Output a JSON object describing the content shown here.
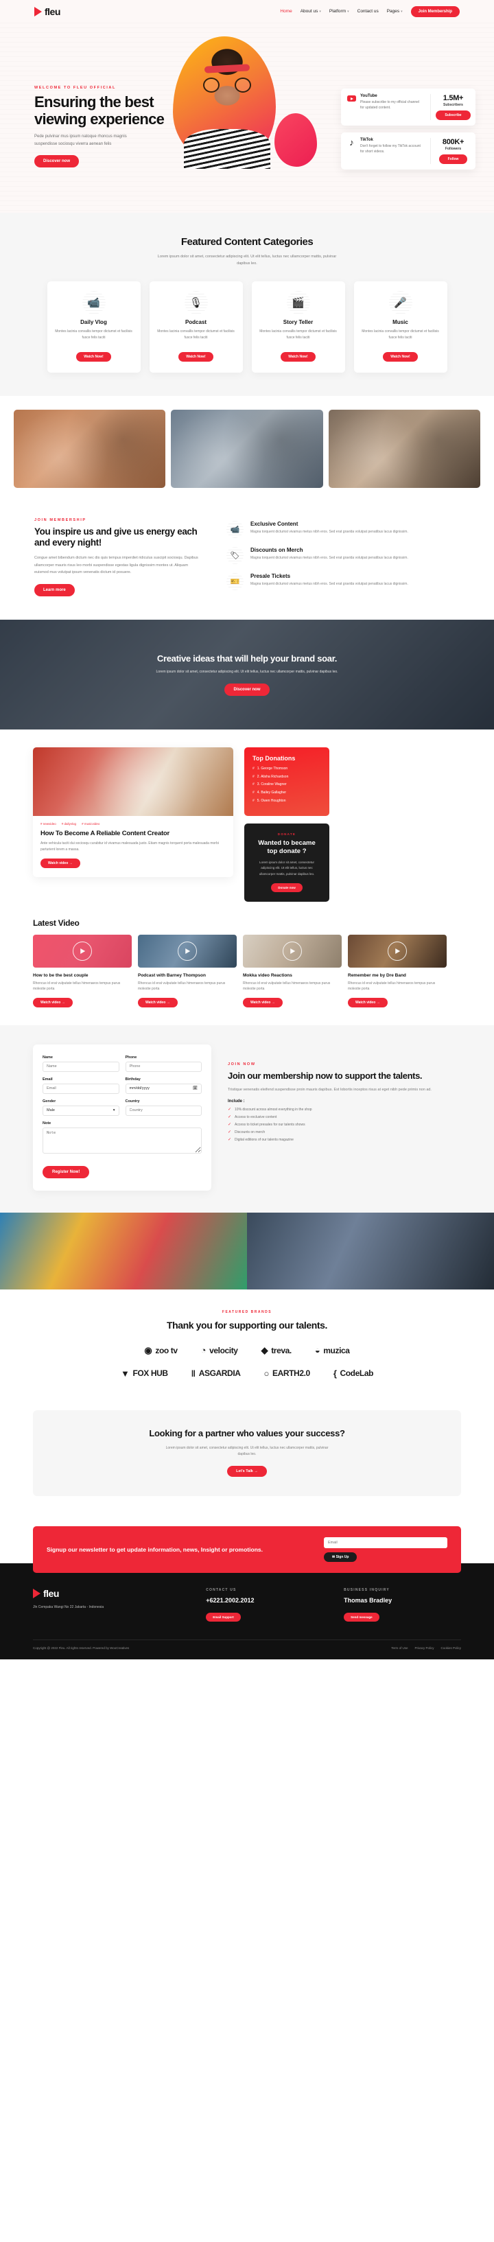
{
  "brand": {
    "name": "fleu",
    "logo_icon": "play-triangle-icon"
  },
  "nav": {
    "items": [
      {
        "label": "Home",
        "active": true,
        "dropdown": false
      },
      {
        "label": "About us",
        "active": false,
        "dropdown": true
      },
      {
        "label": "Platform",
        "active": false,
        "dropdown": true
      },
      {
        "label": "Contact us",
        "active": false,
        "dropdown": false
      },
      {
        "label": "Pages",
        "active": false,
        "dropdown": true
      }
    ],
    "cta_label": "Join Membership"
  },
  "hero": {
    "eyebrow": "WELCOME TO FLEU OFFICIAL",
    "title": "Ensuring the best viewing experience",
    "desc": "Pede pulvinar mus ipsum natoque rhoncus magnis suspendisse sociosqu viverra aenean felis",
    "cta_label": "Discover now",
    "social_cards": [
      {
        "name": "YouTube",
        "icon": "youtube-icon",
        "desc": "Please subscribe to my official channel for updated content.",
        "count": "1.5M+",
        "count_label": "Subscribers",
        "button": "Subscribe"
      },
      {
        "name": "TikTok",
        "icon": "tiktok-icon",
        "desc": "Don't forget to follow my TikTok account for short videos.",
        "count": "800K+",
        "count_label": "Followers",
        "button": "Follow"
      }
    ]
  },
  "categories": {
    "title": "Featured Content Categories",
    "subtitle": "Lorem ipsum dolor sit amet, consectetur adipiscing elit. Ut elit tellus, luctus nec ullamcorper mattis, pulvinar dapibus leo.",
    "items": [
      {
        "icon": "video-camera-icon",
        "glyph": "📹",
        "name": "Daily Vlog",
        "desc": "Montes lacinia convallis tempor dictumst et facilisis fusce felis taciti",
        "button": "Watch Now!"
      },
      {
        "icon": "microphone-icon",
        "glyph": "🎙",
        "name": "Podcast",
        "desc": "Montes lacinia convallis tempor dictumst et facilisis fusce felis taciti",
        "button": "Watch Now!"
      },
      {
        "icon": "clapperboard-icon",
        "glyph": "🎬",
        "name": "Story Teller",
        "desc": "Montes lacinia convallis tempor dictumst et facilisis fusce felis taciti",
        "button": "Watch Now!"
      },
      {
        "icon": "mic-stand-icon",
        "glyph": "🎤",
        "name": "Music",
        "desc": "Montes lacinia convallis tempor dictumst et facilisis fusce felis taciti",
        "button": "Watch Now!"
      }
    ]
  },
  "gallery": {
    "images": [
      {
        "alt": "team-hands-together-photo"
      },
      {
        "alt": "man-with-laptop-podcast-photo"
      },
      {
        "alt": "woman-filming-with-camera-photo"
      }
    ]
  },
  "inspire": {
    "eyebrow": "JOIN MEMBERSHIP",
    "title": "You inspire us and give us energy each and every night!",
    "desc": "Congue amet bibendum dictum nec dis quis tempus imperdiet ridiculus suscipit sociosqu. Dapibus ullamcorper mauris risus leo morbi suspendisse egestas ligula dignissim montes ut. Aliquam euismod mus volutpat ipsum venenatis dictum id posuere.",
    "cta_label": "Learn more",
    "features": [
      {
        "icon": "video-camera-icon",
        "glyph": "📹",
        "title": "Exclusive Content",
        "desc": "Magna torquent dictumst vivamus metus nibh eros. Sed erat gravida volutpat penatibus lacus dignissim."
      },
      {
        "icon": "discount-badge-icon",
        "glyph": "🏷",
        "title": "Discounts on Merch",
        "desc": "Magna torquent dictumst vivamus metus nibh eros. Sed erat gravida volutpat penatibus lacus dignissim."
      },
      {
        "icon": "ticket-icon",
        "glyph": "🎫",
        "title": "Presale Tickets",
        "desc": "Magna torquent dictumst vivamus metus nibh eros. Sed erat gravida volutpat penatibus lacus dignissim."
      }
    ]
  },
  "banner": {
    "title": "Creative ideas that will help your brand soar.",
    "desc": "Lorem ipsum dolor sit amet, consectetur adipiscing elit. Ut elit tellus, luctus nec ullamcorper mattis, pulvinar dapibus leo.",
    "cta_label": "Discover now"
  },
  "blog": {
    "image_alt": "woman-writing-at-desk-photo",
    "tags": [
      "newvideo",
      "dailyvlog",
      "musicvideo"
    ],
    "title": "How To Become A Reliable Content Creator",
    "desc": "Ante vehicula taciti dui sociosqu curabitur id vivamus malesuada justo. Etiam magnis torquent porta malesuada morbi parturient lorem a massa.",
    "cta_label": "Watch video  →"
  },
  "donations": {
    "title": "Top Donations",
    "items": [
      "1. George Thomson",
      "2. Alisha Richardson",
      "3. Coraline Wagner",
      "4. Bailey Gallagher",
      "5. Owen Houghton"
    ],
    "cta": {
      "eyebrow": "DONATE",
      "title": "Wanted to became top donate ?",
      "desc": "Lorem ipsum dolor sit amet, consectetur adipiscing elit. Ut elit tellus, luctus nec ullamcorper mattis, pulvinar dapibus leo.",
      "button": "Donate now"
    }
  },
  "latest_video": {
    "title": "Latest Video",
    "items": [
      {
        "thumb": "couple-pink-background-photo",
        "title": "How to be the best couple",
        "desc": "Rhoncus id erat vulputate tellus himenaeos tempus purus molestie porta",
        "button": "Watch video  →"
      },
      {
        "thumb": "podcast-studio-photo",
        "title": "Podcast with Barney Thompson",
        "desc": "Rhoncus id erat vulputate tellus himenaeos tempus purus molestie porta",
        "button": "Watch video  →"
      },
      {
        "thumb": "group-cheering-on-sofa-photo",
        "title": "Mokka video Reactions",
        "desc": "Rhoncus id erat vulputate tellus himenaeos tempus purus molestie porta",
        "button": "Watch video  →"
      },
      {
        "thumb": "singer-with-microphone-photo",
        "title": "Remember me by Dre Band",
        "desc": "Rhoncus id erat vulputate tellus himenaeos tempus purus molestie porta",
        "button": "Watch video  →"
      }
    ]
  },
  "membership": {
    "eyebrow": "JOIN NOW",
    "title": "Join our membership now to support the talents.",
    "desc": "Tristique venenatis eleifend suspendisse proin mauris dapibus. Est lobortis inceptos risus at eget nibh pede primis non ad.",
    "include_label": "Include :",
    "benefits": [
      "10% discount across almost everything in the shop",
      "Access to exclusive content",
      "Access to ticket presales for our talents shows",
      "Discounts on merch",
      "Digital editions of our talents magazine"
    ],
    "form": {
      "fields": [
        {
          "label": "Name",
          "placeholder": "Name",
          "type": "text",
          "name": "name-field"
        },
        {
          "label": "Phone",
          "placeholder": "Phone",
          "type": "text",
          "name": "phone-field"
        },
        {
          "label": "Email",
          "placeholder": "Email",
          "type": "email",
          "name": "email-field"
        },
        {
          "label": "Birthday",
          "placeholder": "mm/dd/yyyy",
          "type": "date",
          "name": "birthday-field"
        },
        {
          "label": "Gender",
          "value": "Male",
          "type": "select",
          "name": "gender-select"
        },
        {
          "label": "Country",
          "placeholder": "Country",
          "type": "text",
          "name": "country-field"
        },
        {
          "label": "Note",
          "placeholder": "Note",
          "type": "textarea",
          "name": "note-field"
        }
      ],
      "submit_label": "Register Now!"
    }
  },
  "photo_strip": {
    "images": [
      {
        "alt": "group-of-friends-cheering-photo"
      },
      {
        "alt": "man-with-headset-at-computer-photo"
      }
    ]
  },
  "brands": {
    "eyebrow": "FEATURED BRANDS",
    "title": "Thank you for supporting our talents.",
    "rows": [
      [
        {
          "icon": "circle-play-icon",
          "glyph": "◉",
          "name": "zoo tv"
        },
        {
          "icon": "signal-icon",
          "glyph": "◔",
          "name": "velocity"
        },
        {
          "icon": "leaf-icon",
          "glyph": "◆",
          "name": "treva."
        },
        {
          "icon": "note-icon",
          "glyph": "◒",
          "name": "muzica"
        }
      ],
      [
        {
          "icon": "fox-shield-icon",
          "glyph": "▼",
          "name": "FOX HUB"
        },
        {
          "icon": "bars-icon",
          "glyph": "‖",
          "name": "ASGARDIA"
        },
        {
          "icon": "globe-icon",
          "glyph": "○",
          "name": "EARTH2.0"
        },
        {
          "icon": "brackets-icon",
          "glyph": "{",
          "name": "CodeLab"
        }
      ]
    ]
  },
  "partner": {
    "title": "Looking for a partner who values your success?",
    "desc": "Lorem ipsum dolor sit amet, consectetur adipiscing elit. Ut elit tellus, luctus nec ullamcorper mattis, pulvinar dapibus leo.",
    "cta_label": "Let's Talk  →"
  },
  "newsletter": {
    "text": "Signup our newsletter to get update information, news, Insight or promotions.",
    "placeholder": "Email",
    "button": "✉ Sign Up"
  },
  "footer": {
    "address": "Jln Cempaka Wangi No 22 Jakarta - Indonesia",
    "contact_head": "CONTACT US",
    "phone": "+6221.2002.2012",
    "contact_btn": "Email Support",
    "business_head": "BUSINESS INQUIRY",
    "person": "Thomas Bradley",
    "business_btn": "Send message",
    "copyright": "Copyright @ 2022 Fleu. All rights reserved. Powered by WooCreatives",
    "links": [
      "Term of Use",
      "Privacy Policy",
      "Cookies Policy"
    ]
  },
  "colors": {
    "accent": "#ee2737",
    "dark": "#111111",
    "gray_bg": "#f6f6f6"
  }
}
